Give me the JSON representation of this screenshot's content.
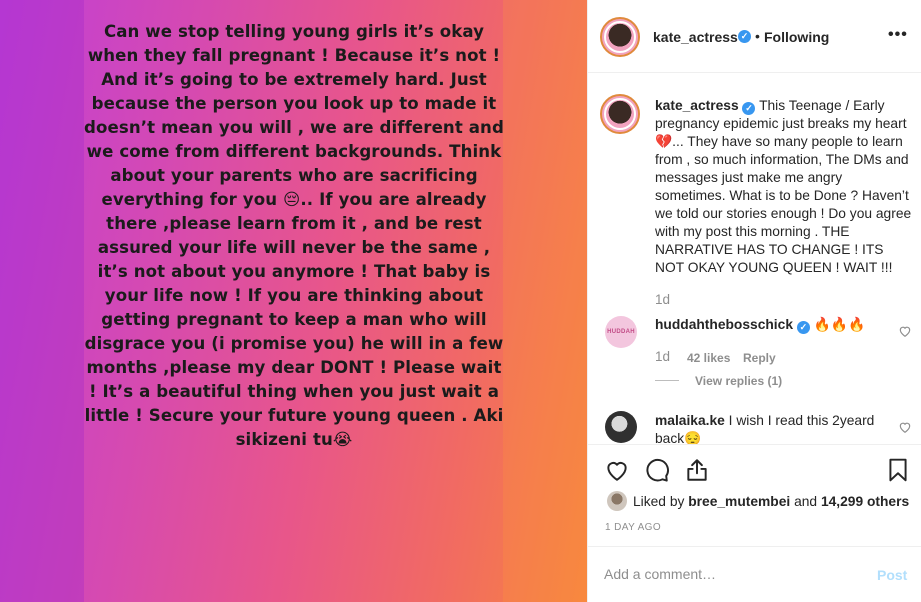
{
  "story": {
    "text": "Can we stop telling young girls it’s okay when they fall pregnant ! Because it’s not ! And it’s going to be extremely hard. Just because the person you look up to made it doesn’t mean you will , we are different and we come from different backgrounds. Think about your parents who are sacrificing everything for you 😔.. If you are already there ,please learn from it , and be rest assured your life will never be the same , it’s not about you anymore ! That baby is your life now ! If you are thinking about getting pregnant to keep a man who will disgrace you (i promise you) he will in a few months ,please my dear DONT ! Please wait ! It’s a beautiful thing when you just wait a little ! Secure your future young queen . Aki sikizeni tu😭"
  },
  "header": {
    "username": "kate_actress",
    "dot": "•",
    "follow_label": "Following",
    "more": "•••"
  },
  "caption": {
    "username": "kate_actress",
    "text": "This Teenage / Early pregnancy epidemic just breaks my heart 💔... They have so many people to learn from , so much information, The DMs and messages just make me angry sometimes. What is to be Done ? Haven’t we told our stories enough ! Do you agree with my post this morning . THE NARRATIVE HAS TO CHANGE ! ITS NOT OKAY YOUNG QUEEN ! WAIT !!!",
    "time": "1d"
  },
  "comments": [
    {
      "username": "huddahthebosschick",
      "text": "🔥🔥🔥",
      "avatar_text": "HUDDAH",
      "time": "1d",
      "likes": "42 likes",
      "reply_label": "Reply",
      "view_replies": "View replies (1)"
    },
    {
      "username": "malaika.ke",
      "text": "I wish I read this 2yeard back😔"
    }
  ],
  "likes": {
    "prefix": "Liked by",
    "user": "bree_mutembei",
    "conjunction": "and",
    "others": "14,299 others"
  },
  "post_date": "1 DAY AGO",
  "comment_box": {
    "placeholder": "Add a comment…",
    "post_label": "Post"
  },
  "icons": {
    "verified": "verified-badge-icon",
    "like": "heart-icon",
    "comment": "comment-icon",
    "share": "share-icon",
    "save": "bookmark-icon"
  },
  "colors": {
    "verified": "#3897f0",
    "post_disabled": "#b2dffc",
    "secondary_text": "#8e8e8e"
  }
}
